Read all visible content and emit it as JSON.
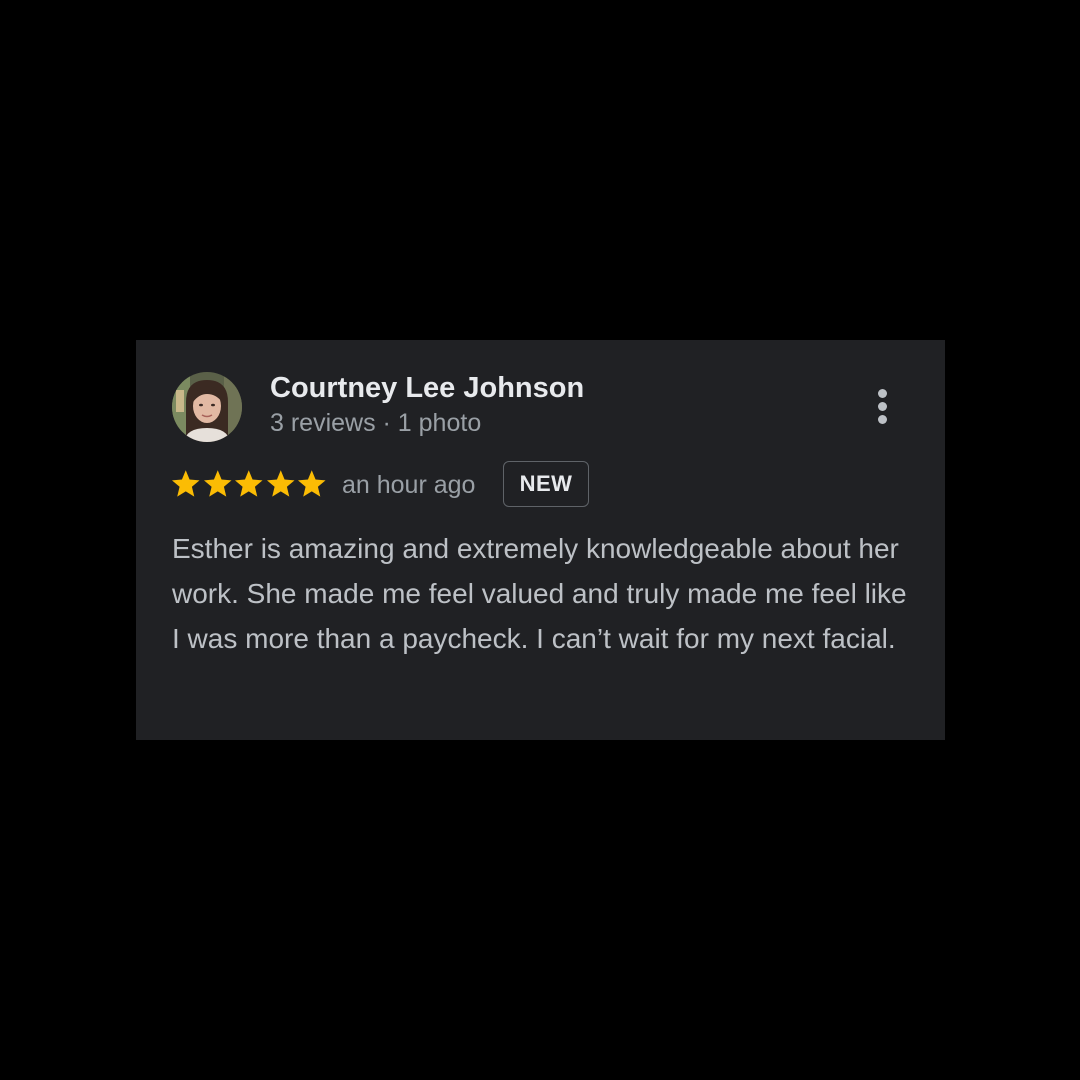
{
  "review": {
    "reviewer_name": "Courtney Lee Johnson",
    "reviewer_meta": "3 reviews · 1 photo",
    "rating": 5,
    "rating_max": 5,
    "time_ago": "an hour ago",
    "badge": "NEW",
    "text": "Esther is amazing and extremely knowledgeable about her work. She made me feel valued and truly made me feel like I was more than a paycheck. I can’t wait for my next facial."
  },
  "icons": {
    "star": "star-icon",
    "more": "more-vert-icon"
  },
  "colors": {
    "page_background": "#000000",
    "card_background": "#202124",
    "star": "#fbbc04",
    "primary_text": "#e8eaed",
    "secondary_text": "#9aa0a6",
    "body_text": "#bdc1c6"
  }
}
